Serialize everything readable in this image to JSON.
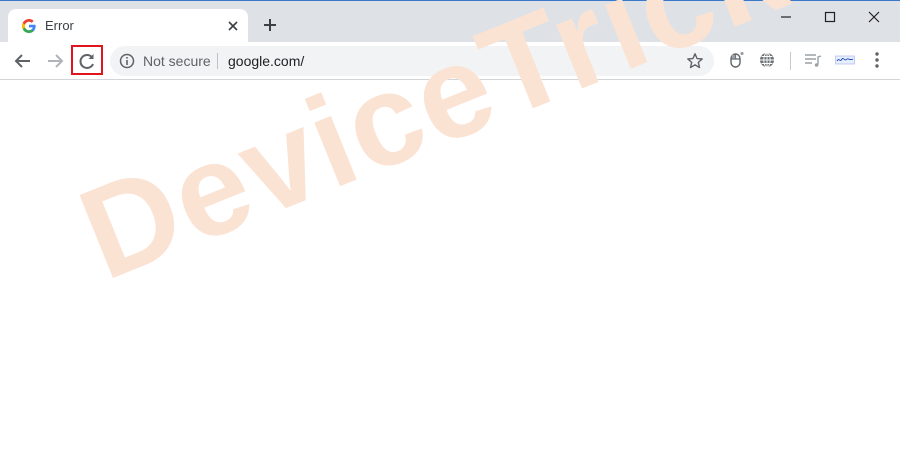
{
  "tab": {
    "title": "Error"
  },
  "omnibox": {
    "security_label": "Not secure",
    "url": "google.com/"
  },
  "watermark": {
    "text": "DeviceTricks"
  },
  "colors": {
    "accent": "#e0141c",
    "titlebar": "#dee1e6",
    "watermark": "#fbe3d4"
  }
}
